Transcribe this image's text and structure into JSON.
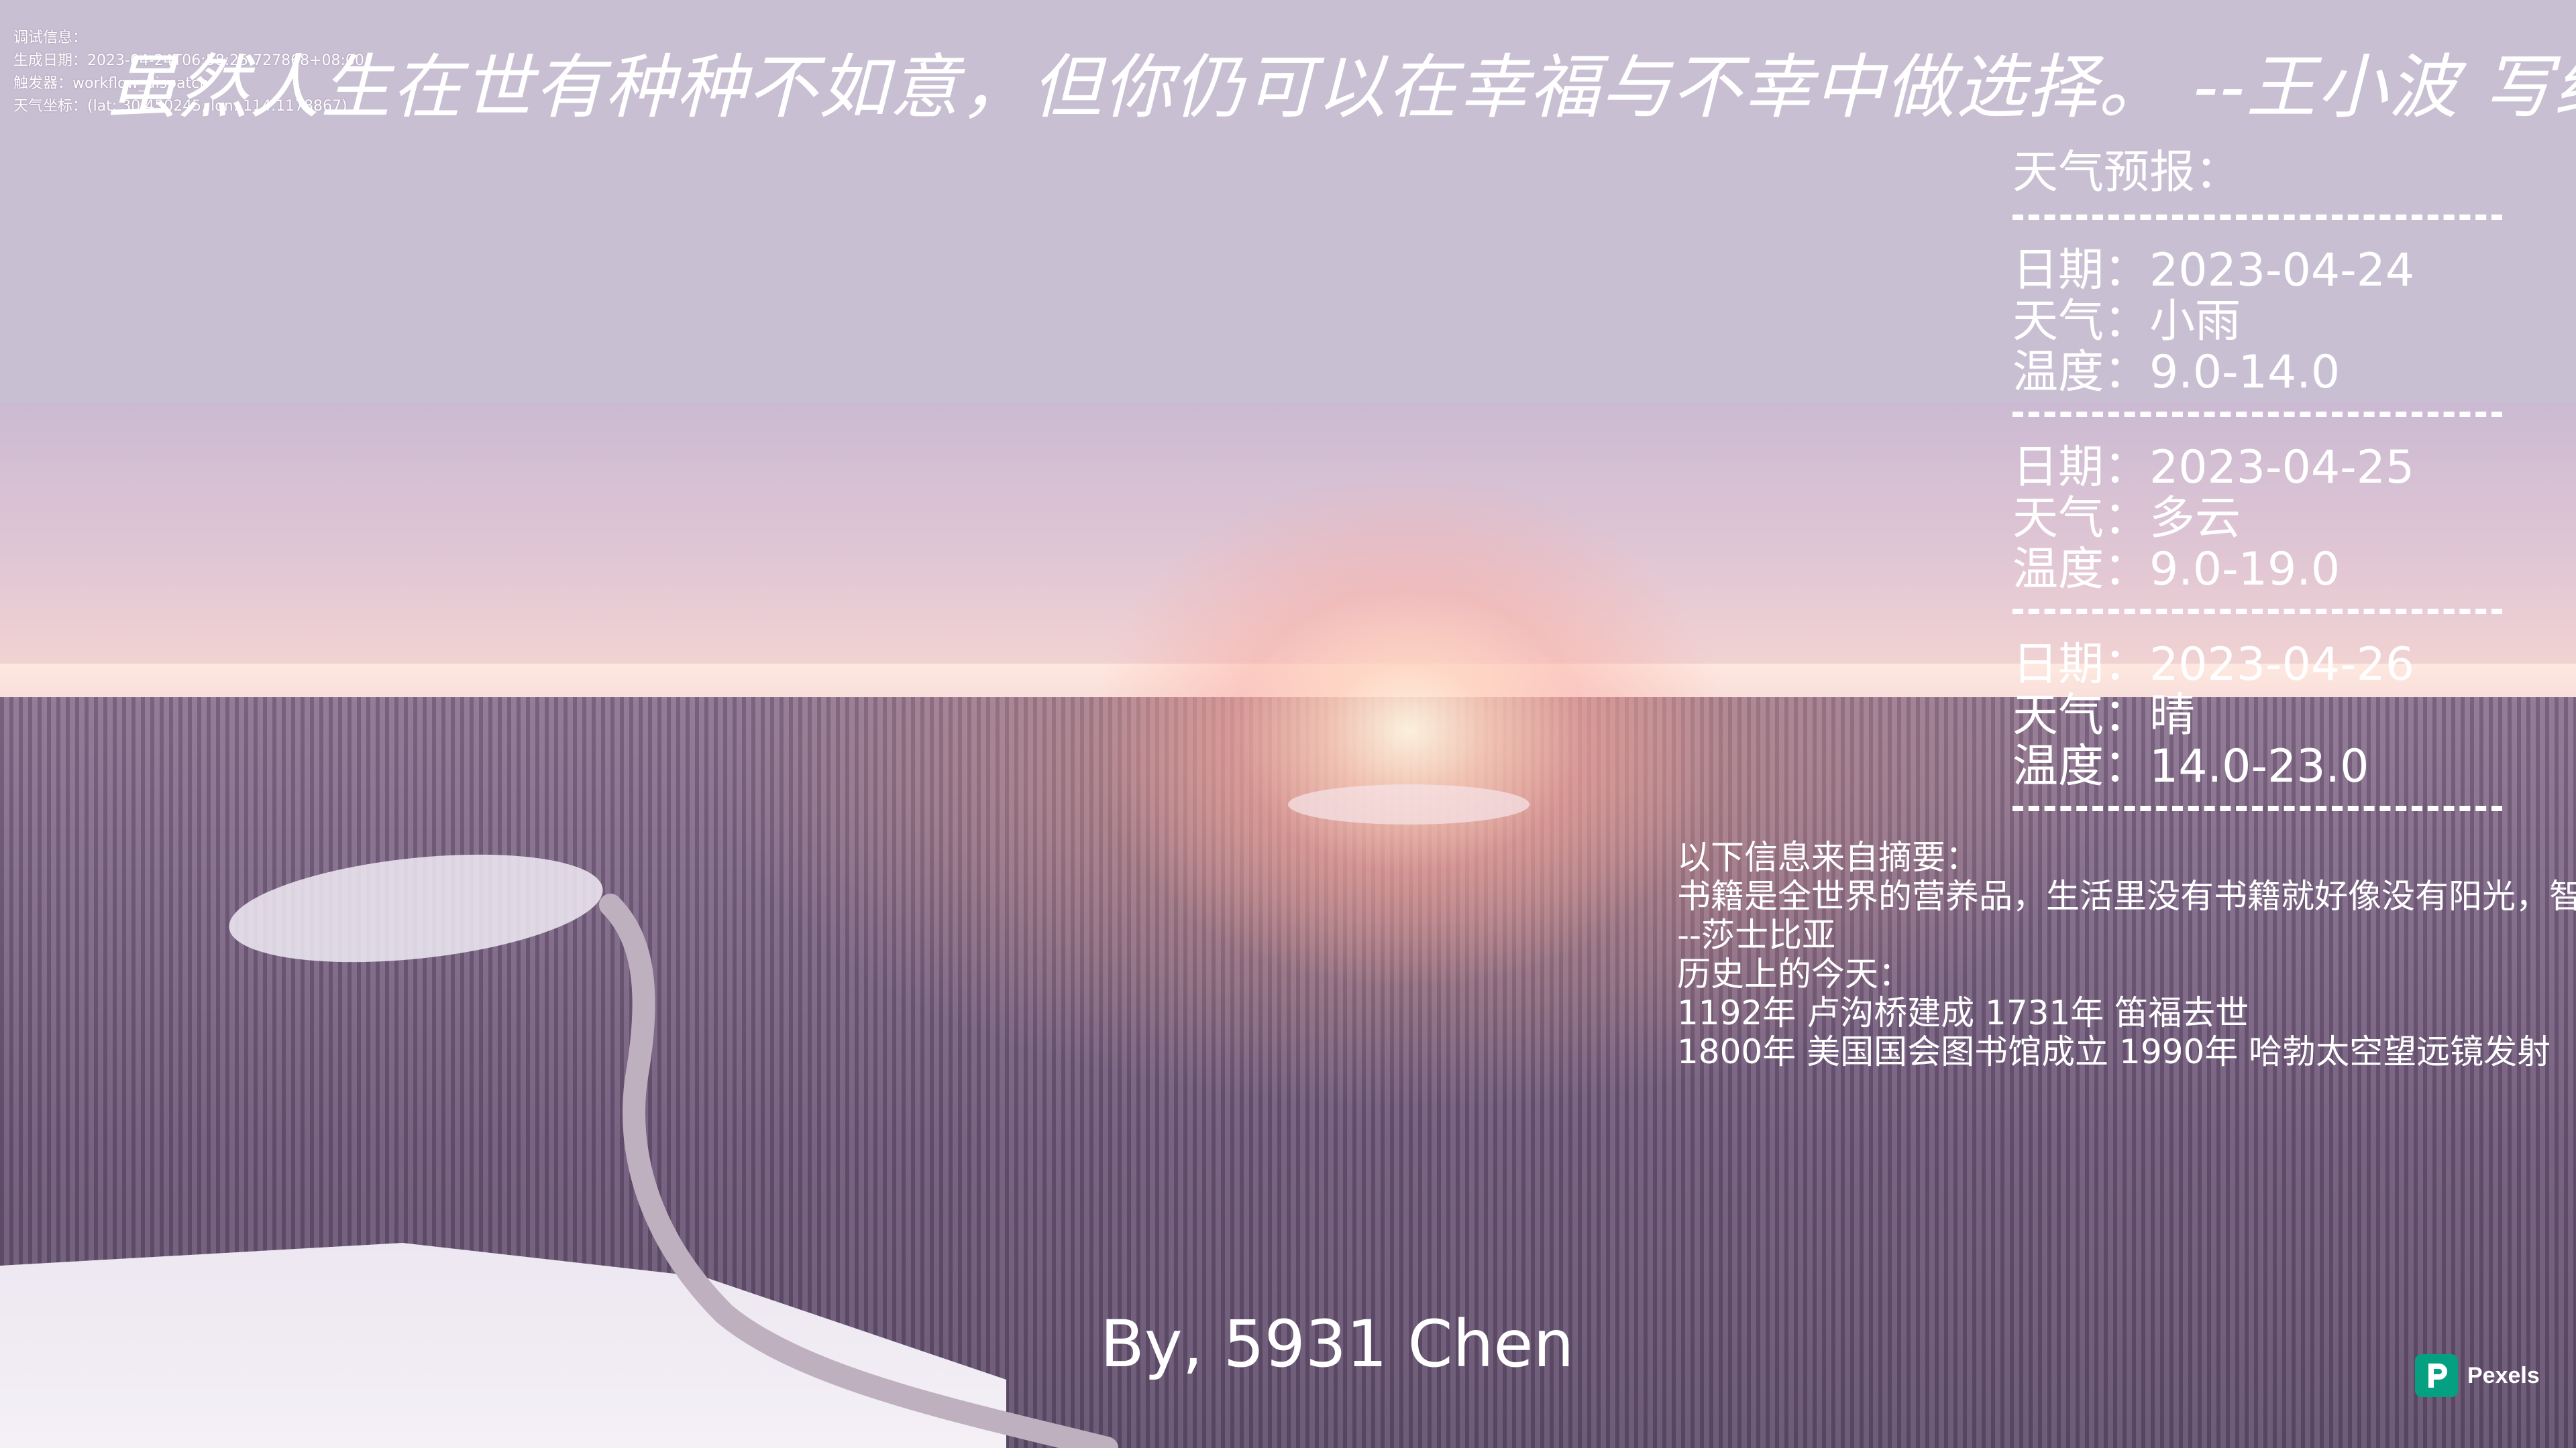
{
  "debug": {
    "title": "调试信息：",
    "generated": "生成日期：2023-04-24T06:58:25.727868+08:00",
    "trigger": "触发器：workflow_dispatch",
    "coords": "天气坐标：(lat: 30.450245, lon: 114.1178867)"
  },
  "quote": "虽然人生在世有种种不如意，但你仍可以在幸福与不幸中做选择。 --王小波 写给新的一年",
  "weather": {
    "title": "天气预报：",
    "days": [
      {
        "date": "日期：2023-04-24",
        "weather": "天气：小雨",
        "temp": "温度：9.0-14.0"
      },
      {
        "date": "日期：2023-04-25",
        "weather": "天气：多云",
        "temp": "温度：9.0-19.0"
      },
      {
        "date": "日期：2023-04-26",
        "weather": "天气：晴",
        "temp": "温度：14.0-23.0"
      }
    ]
  },
  "info": {
    "source": "以下信息来自摘要：",
    "book_quote": "书籍是全世界的营养品，生活里没有书籍就好像没有阳光，智慧里没有书籍就好像鸟儿没有翅膀。",
    "book_author": "--莎士比亚",
    "history_title": "历史上的今天：",
    "history_1": "1192年 卢沟桥建成 1731年 笛福去世",
    "history_2": "1800年 美国国会图书馆成立 1990年 哈勃太空望远镜发射"
  },
  "author": "By, 5931 Chen",
  "watermark": {
    "label": "Pexels",
    "color": "#05a081"
  }
}
